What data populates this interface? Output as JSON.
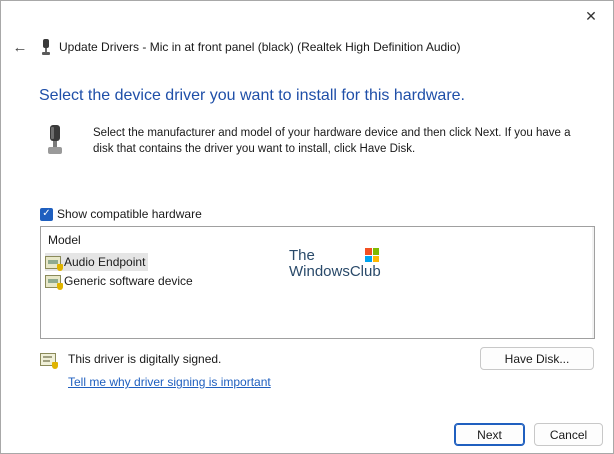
{
  "window": {
    "title": "Update Drivers - Mic in at front panel (black) (Realtek High Definition Audio)",
    "close_glyph": "✕",
    "back_glyph": "←"
  },
  "main": {
    "heading": "Select the device driver you want to install for this hardware.",
    "instructions": "Select the manufacturer and model of your hardware device and then click Next. If you have a disk that contains the driver you want to install, click Have Disk."
  },
  "compatible": {
    "checked": true,
    "check_glyph": "✓",
    "label": "Show compatible hardware"
  },
  "model_list": {
    "header": "Model",
    "items": [
      {
        "label": "Audio Endpoint",
        "selected": true
      },
      {
        "label": "Generic software device",
        "selected": false
      }
    ]
  },
  "watermark": {
    "line1": "The",
    "line2": "WindowsClub"
  },
  "signing": {
    "status": "This driver is digitally signed.",
    "link": "Tell me why driver signing is important"
  },
  "buttons": {
    "have_disk": "Have Disk...",
    "next": "Next",
    "cancel": "Cancel"
  },
  "colors": {
    "accent": "#1f5fbf",
    "heading": "#1f4fa8"
  },
  "icons": {
    "back": "back-arrow-icon",
    "close": "close-icon",
    "device": "microphone-device-icon",
    "driver_item": "driver-package-icon",
    "certificate": "certificate-icon"
  }
}
